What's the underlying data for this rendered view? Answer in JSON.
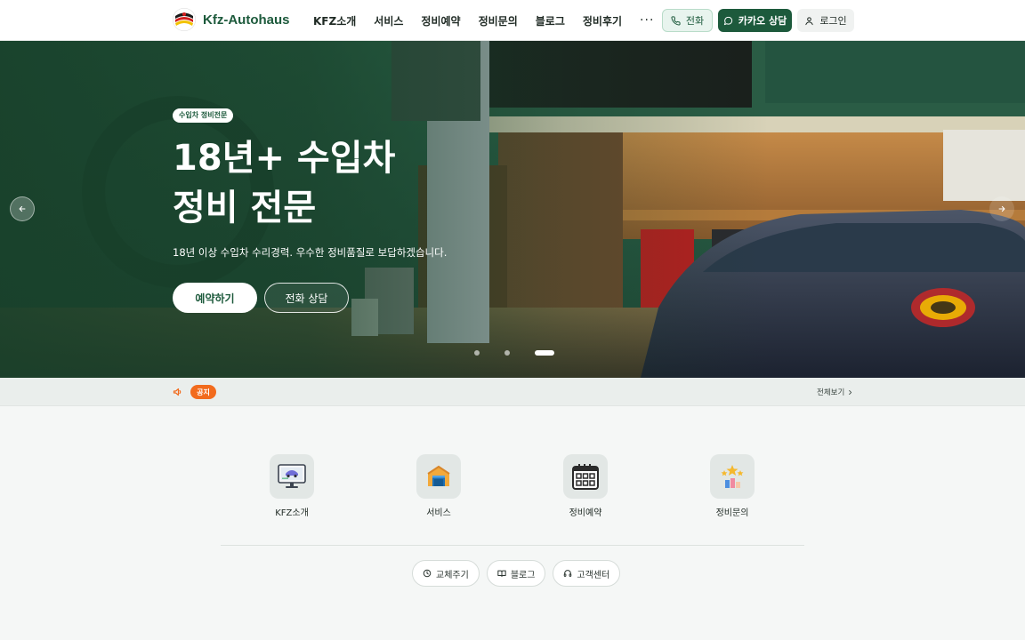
{
  "header": {
    "brand": "Kfz-Autohaus",
    "nav": [
      "KFZ소개",
      "서비스",
      "정비예약",
      "정비문의",
      "블로그",
      "정비후기"
    ],
    "more": "···",
    "call_label": "전화",
    "kakao_label": "카카오 상담",
    "login_label": "로그인"
  },
  "hero": {
    "badge": "수입차 정비전문",
    "title_line1": "18년+ 수입차",
    "title_line2": "정비 전문",
    "subtitle": "18년 이상 수입차 수리경력. 우수한 정비품질로 보답하겠습니다.",
    "primary_button": "예약하기",
    "secondary_button": "전화 상담",
    "slides_total": 3,
    "slide_active": 3
  },
  "notice": {
    "badge": "공지",
    "view_all": "전체보기"
  },
  "quick_menu": [
    {
      "label": "KFZ소개",
      "icon": "monitor-car-icon"
    },
    {
      "label": "서비스",
      "icon": "garage-icon"
    },
    {
      "label": "정비예약",
      "icon": "calendar-icon"
    },
    {
      "label": "정비문의",
      "icon": "review-stars-icon"
    }
  ],
  "pills": [
    {
      "label": "교체주기",
      "icon": "clock-icon"
    },
    {
      "label": "블로그",
      "icon": "book-icon"
    },
    {
      "label": "고객센터",
      "icon": "headset-icon"
    }
  ],
  "colors": {
    "brand_green": "#1d5a3c",
    "notice_orange": "#f26b1d"
  }
}
